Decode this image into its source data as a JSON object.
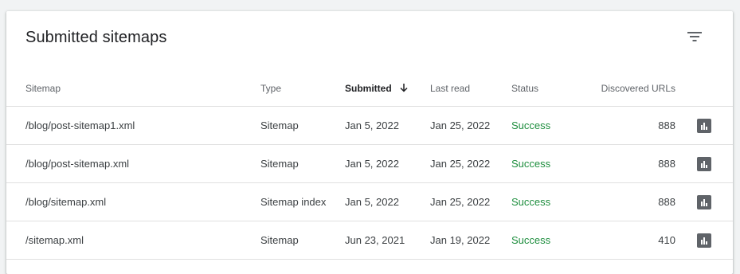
{
  "card": {
    "title": "Submitted sitemaps",
    "filter_icon": "filter-icon"
  },
  "columns": {
    "sitemap": "Sitemap",
    "type": "Type",
    "submitted": "Submitted",
    "last_read": "Last read",
    "status": "Status",
    "discovered_urls": "Discovered URLs"
  },
  "sort": {
    "column": "submitted",
    "direction": "descending",
    "icon": "arrow-down-icon"
  },
  "rows": [
    {
      "sitemap": "/blog/post-sitemap1.xml",
      "type": "Sitemap",
      "submitted": "Jan 5, 2022",
      "last_read": "Jan 25, 2022",
      "status": "Success",
      "discovered_urls": "888"
    },
    {
      "sitemap": "/blog/post-sitemap.xml",
      "type": "Sitemap",
      "submitted": "Jan 5, 2022",
      "last_read": "Jan 25, 2022",
      "status": "Success",
      "discovered_urls": "888"
    },
    {
      "sitemap": "/blog/sitemap.xml",
      "type": "Sitemap index",
      "submitted": "Jan 5, 2022",
      "last_read": "Jan 25, 2022",
      "status": "Success",
      "discovered_urls": "888"
    },
    {
      "sitemap": "/sitemap.xml",
      "type": "Sitemap",
      "submitted": "Jun 23, 2021",
      "last_read": "Jan 19, 2022",
      "status": "Success",
      "discovered_urls": "410"
    }
  ],
  "row_action_icon": "bar-chart-icon",
  "colors": {
    "success": "#1e8e3e",
    "text": "#3c4043",
    "header_text": "#5f6368",
    "divider": "#e0e0e0",
    "page_bg": "#f1f3f4"
  }
}
